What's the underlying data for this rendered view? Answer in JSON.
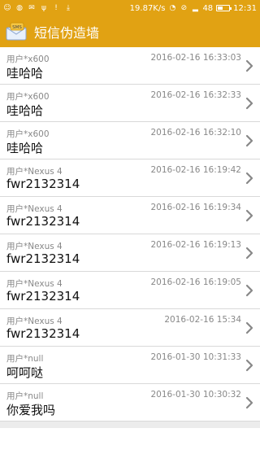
{
  "status_bar": {
    "speed": "19.87K/s",
    "battery": "48",
    "battery_level": 0.48,
    "time": "12:31"
  },
  "app": {
    "title": "短信伪造墙",
    "logo_text": "SMS"
  },
  "messages": [
    {
      "user": "用户*x600",
      "time": "2016-02-16 16:33:03",
      "text": "哇哈哈"
    },
    {
      "user": "用户*x600",
      "time": "2016-02-16 16:32:33",
      "text": "哇哈哈"
    },
    {
      "user": "用户*x600",
      "time": "2016-02-16 16:32:10",
      "text": "哇哈哈"
    },
    {
      "user": "用户*Nexus 4",
      "time": "2016-02-16 16:19:42",
      "text": "fwr2132314"
    },
    {
      "user": "用户*Nexus 4",
      "time": "2016-02-16 16:19:34",
      "text": "fwr2132314"
    },
    {
      "user": "用户*Nexus 4",
      "time": "2016-02-16 16:19:13",
      "text": "fwr2132314"
    },
    {
      "user": "用户*Nexus 4",
      "time": "2016-02-16 16:19:05",
      "text": "fwr2132314"
    },
    {
      "user": "用户*Nexus 4",
      "time": "2016-02-16 15:34",
      "text": "fwr2132314"
    },
    {
      "user": "用户*null",
      "time": "2016-01-30 10:31:33",
      "text": "呵呵哒"
    },
    {
      "user": "用户*null",
      "time": "2016-01-30 10:30:32",
      "text": "你爱我吗"
    }
  ]
}
